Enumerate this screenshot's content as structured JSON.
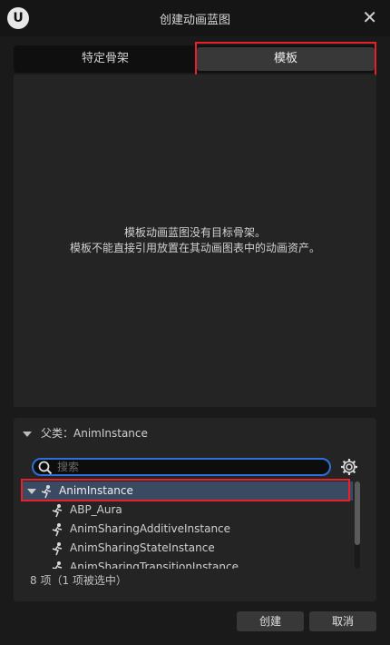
{
  "window": {
    "title": "创建动画蓝图",
    "logo_text": "U",
    "close_glyph": "✕"
  },
  "tabs": [
    {
      "label": "特定骨架",
      "selected": false
    },
    {
      "label": "模板",
      "selected": true
    }
  ],
  "preview": {
    "message_line1": "模板动画蓝图没有目标骨架。",
    "message_line2": "模板不能直接引用放置在其动画图表中的动画资产。"
  },
  "parent_class": {
    "header": "父类：AnimInstance",
    "search_placeholder": "搜索",
    "search_value": "",
    "items": [
      {
        "label": "AnimInstance",
        "selected": true,
        "expanded": true
      },
      {
        "label": "ABP_Aura",
        "selected": false
      },
      {
        "label": "AnimSharingAdditiveInstance",
        "selected": false
      },
      {
        "label": "AnimSharingStateInstance",
        "selected": false
      },
      {
        "label": "AnimSharingTransitionInstance",
        "selected": false
      }
    ],
    "count_text": "8 项（1 项被选中）"
  },
  "buttons": {
    "create": "创建",
    "cancel": "取消"
  },
  "colors": {
    "highlight_border": "#e8202a",
    "selection_bg": "#3a4a63",
    "search_focus": "#2f6fd8"
  }
}
